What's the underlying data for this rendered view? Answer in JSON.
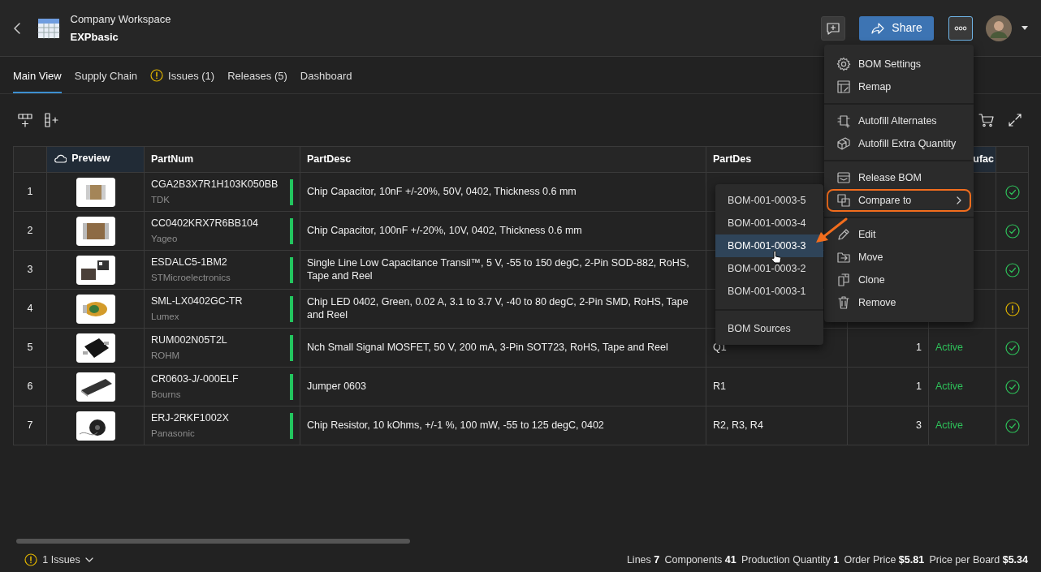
{
  "header": {
    "workspace": "Company Workspace",
    "project": "EXPbasic",
    "share": "Share",
    "menu_open": true
  },
  "tabs": [
    {
      "label": "Main View",
      "selected": true,
      "warning": false
    },
    {
      "label": "Supply Chain",
      "selected": false,
      "warning": false
    },
    {
      "label": "Issues (1)",
      "selected": false,
      "warning": true
    },
    {
      "label": "Releases (5)",
      "selected": false,
      "warning": false
    },
    {
      "label": "Dashboard",
      "selected": false,
      "warning": false
    }
  ],
  "table": {
    "columns": {
      "preview": "Preview",
      "part_number": "PartNum",
      "description": "PartDesc",
      "designators": "PartDes",
      "column_6": "ufac"
    },
    "rows": [
      {
        "index": "1",
        "part_number": "CGA2B3X7R1H103K050BB",
        "manufacturer": "TDK",
        "description": "Chip Capacitor, 10nF +/-20%, 50V, 0402, Thickness 0.6 mm",
        "kind": "ok"
      },
      {
        "index": "2",
        "part_number": "CC0402KRX7R6BB104",
        "manufacturer": "Yageo",
        "description": "Chip Capacitor, 100nF +/-20%, 10V, 0402, Thickness 0.6 mm",
        "kind": "ok"
      },
      {
        "index": "3",
        "part_number": "ESDALC5-1BM2",
        "manufacturer": "STMicroelectronics",
        "description": "Single Line Low Capacitance Transil™, 5 V, -55 to 150 degC, 2-Pin SOD-882, RoHS, Tape and Reel",
        "kind": "ok"
      },
      {
        "index": "4",
        "part_number": "SML-LX0402GC-TR",
        "manufacturer": "Lumex",
        "description": "Chip LED 0402, Green, 0.02 A, 3.1 to 3.7 V, -40 to 80 degC, 2-Pin SMD, RoHS, Tape and Reel",
        "kind": "warning"
      },
      {
        "index": "5",
        "part_number": "RUM002N05T2L",
        "manufacturer": "ROHM",
        "description": "Nch Small Signal MOSFET, 50 V, 200 mA, 3-Pin SOT723, RoHS, Tape and Reel",
        "designators": "Q1",
        "quantity": "1",
        "lifecycle": "Active",
        "kind": "ok"
      },
      {
        "index": "6",
        "part_number": "CR0603-J/-000ELF",
        "manufacturer": "Bourns",
        "description": "Jumper 0603",
        "designators": "R1",
        "quantity": "1",
        "lifecycle": "Active",
        "kind": "ok"
      },
      {
        "index": "7",
        "part_number": "ERJ-2RKF1002X",
        "manufacturer": "Panasonic",
        "description": "Chip Resistor, 10 kOhms, +/-1 %, 100 mW, -55 to 125 degC, 0402",
        "designators": "R2, R3, R4",
        "quantity": "3",
        "lifecycle": "Active",
        "kind": "ok"
      }
    ]
  },
  "menu": {
    "groups": [
      [
        {
          "label": "BOM Settings",
          "highlighted": false,
          "submenu": false
        },
        {
          "label": "Remap",
          "highlighted": false,
          "submenu": false
        }
      ],
      [
        {
          "label": "Autofill Alternates",
          "highlighted": false,
          "submenu": false
        },
        {
          "label": "Autofill Extra Quantity",
          "highlighted": false,
          "submenu": false
        }
      ],
      [
        {
          "label": "Release BOM",
          "highlighted": false,
          "submenu": false
        },
        {
          "label": "Compare to",
          "highlighted": true,
          "submenu": true
        }
      ],
      [
        {
          "label": "Edit",
          "highlighted": false,
          "submenu": false
        },
        {
          "label": "Move",
          "highlighted": false,
          "submenu": false
        },
        {
          "label": "Clone",
          "highlighted": false,
          "submenu": false
        },
        {
          "label": "Remove",
          "highlighted": false,
          "submenu": false
        }
      ]
    ]
  },
  "submenu": {
    "items": [
      {
        "label": "BOM-001-0003-5",
        "selected": false
      },
      {
        "label": "BOM-001-0003-4",
        "selected": false
      },
      {
        "label": "BOM-001-0003-3",
        "selected": true
      },
      {
        "label": "BOM-001-0003-2",
        "selected": false
      },
      {
        "label": "BOM-001-0003-1",
        "selected": false
      }
    ],
    "footer": "BOM Sources"
  },
  "status_bar": {
    "issues": "1 Issues",
    "stats": [
      {
        "label": "Lines",
        "value": "7"
      },
      {
        "label": "Components",
        "value": "41"
      },
      {
        "label": "Production Quantity",
        "value": "1"
      },
      {
        "label": "Order Price",
        "value": "$5.81"
      },
      {
        "label": "Price per Board",
        "value": "$5.34"
      }
    ]
  }
}
